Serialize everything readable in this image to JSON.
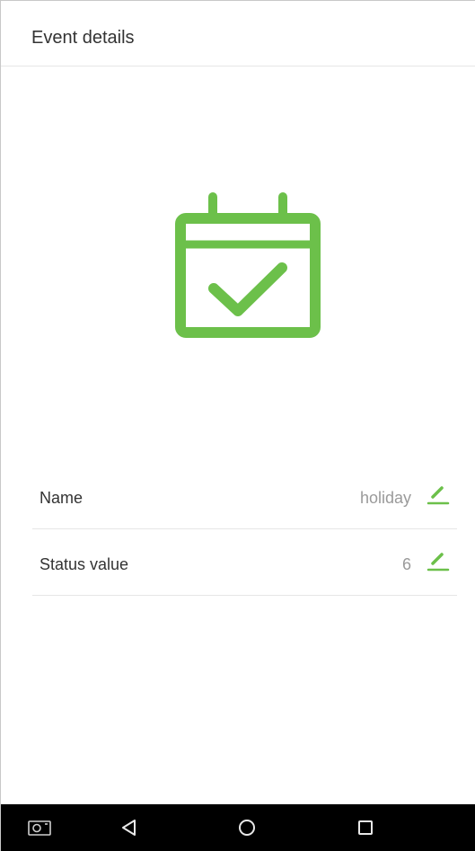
{
  "header": {
    "title": "Event details"
  },
  "hero": {
    "icon": "calendar-check-icon",
    "color": "#6cc04a"
  },
  "fields": [
    {
      "label": "Name",
      "value": "holiday"
    },
    {
      "label": "Status value",
      "value": "6"
    }
  ],
  "accent_color": "#6cc04a",
  "navbar": {
    "buttons": [
      "screenshot-icon",
      "back-icon",
      "home-icon",
      "recents-icon"
    ]
  }
}
